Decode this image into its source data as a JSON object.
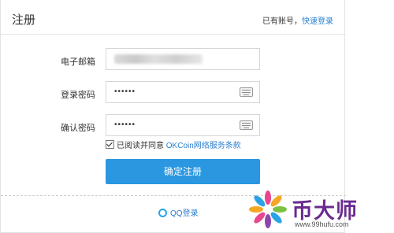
{
  "header": {
    "title": "注册",
    "login_prompt": "已有账号，",
    "login_link": "快速登录"
  },
  "form": {
    "email_label": "电子邮箱",
    "password_label": "登录密码",
    "password_value": "••••••",
    "confirm_label": "确认密码",
    "confirm_value": "••••••",
    "agree_text": "已阅读并同意",
    "agree_link": "OKCoin网络服务条款",
    "agree_checked": true,
    "submit_label": "确定注册"
  },
  "social": {
    "qq_label": "QQ登录"
  },
  "watermark": {
    "name": "币大师",
    "url": "www.99hufu.com"
  },
  "colors": {
    "accent": "#2a97e0",
    "link": "#2b7fd0",
    "watermark": "#6a2b8f"
  }
}
